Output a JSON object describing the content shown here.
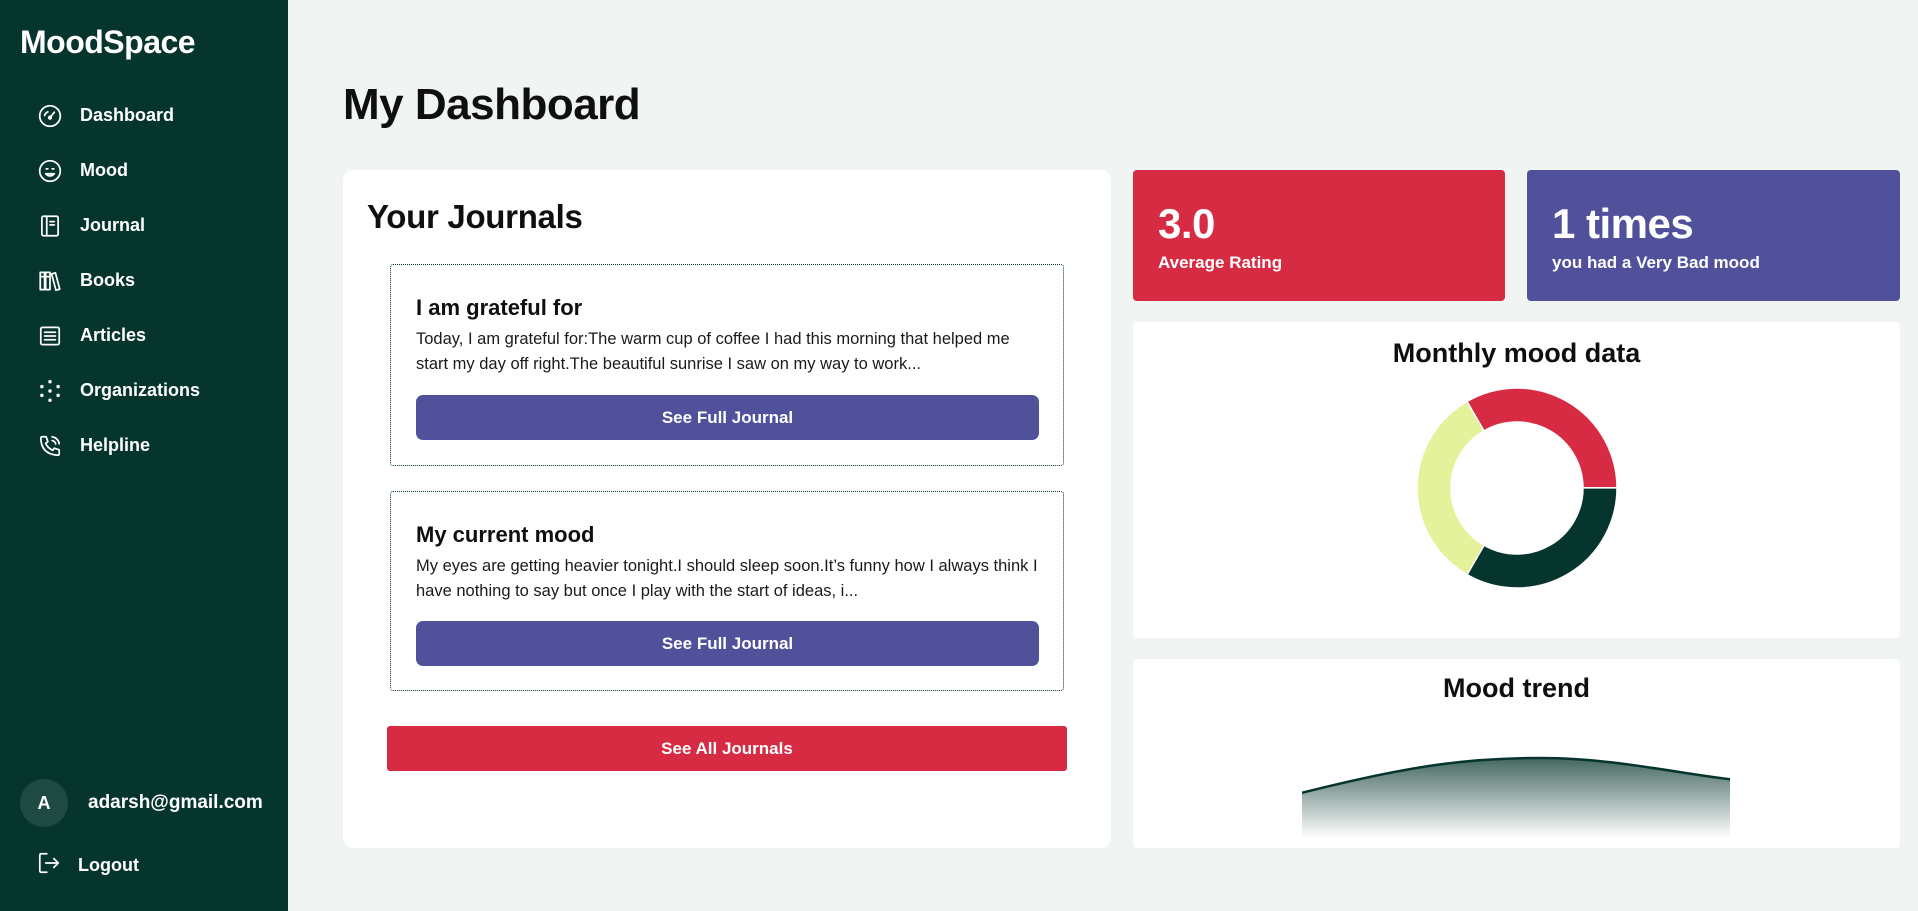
{
  "app": {
    "brand": "MoodSpace"
  },
  "sidebar": {
    "items": [
      {
        "label": "Dashboard",
        "icon": "gauge-icon"
      },
      {
        "label": "Mood",
        "icon": "smiley-icon"
      },
      {
        "label": "Journal",
        "icon": "journal-icon"
      },
      {
        "label": "Books",
        "icon": "books-icon"
      },
      {
        "label": "Articles",
        "icon": "articles-icon"
      },
      {
        "label": "Organizations",
        "icon": "organizations-icon"
      },
      {
        "label": "Helpline",
        "icon": "phone-icon"
      }
    ],
    "user": {
      "avatar_letter": "A",
      "email": "adarsh@gmail.com"
    },
    "logout_label": "Logout"
  },
  "main": {
    "title": "My Dashboard",
    "journals": {
      "heading": "Your Journals",
      "items": [
        {
          "title": "I am grateful for",
          "excerpt": "Today, I am grateful for:The warm cup of coffee I had this morning that helped me start my day off right.The beautiful sunrise I saw on my way to work...",
          "button": "See Full Journal"
        },
        {
          "title": "My current mood",
          "excerpt": "My eyes are getting heavier tonight.I should sleep soon.It’s funny how I always think I have nothing to say but once I play with the start of ideas, i...",
          "button": "See Full Journal"
        }
      ],
      "see_all": "See All Journals"
    },
    "stats": [
      {
        "value": "3.0",
        "label": "Average Rating",
        "color": "#d72a43"
      },
      {
        "value": "1 times",
        "label": "you had a Very Bad mood",
        "color": "#51509b"
      }
    ],
    "monthly": {
      "title": "Monthly mood data"
    },
    "trend": {
      "title": "Mood trend"
    }
  },
  "colors": {
    "sidebar": "#06352d",
    "background": "#f0f5f4",
    "accent_red": "#d72a43",
    "accent_purple": "#51509b",
    "accent_yellow": "#e5f29c"
  },
  "chart_data": [
    {
      "type": "pie",
      "title": "Monthly mood data",
      "donut": true,
      "slices": [
        {
          "value": 1,
          "color": "#d72a43"
        },
        {
          "value": 1,
          "color": "#06352d"
        },
        {
          "value": 1,
          "color": "#e5f29c"
        }
      ]
    },
    {
      "type": "area",
      "title": "Mood trend",
      "x": [
        0,
        1,
        2
      ],
      "y": [
        2.2,
        3.6,
        2.9
      ],
      "color": "#06352d"
    }
  ]
}
